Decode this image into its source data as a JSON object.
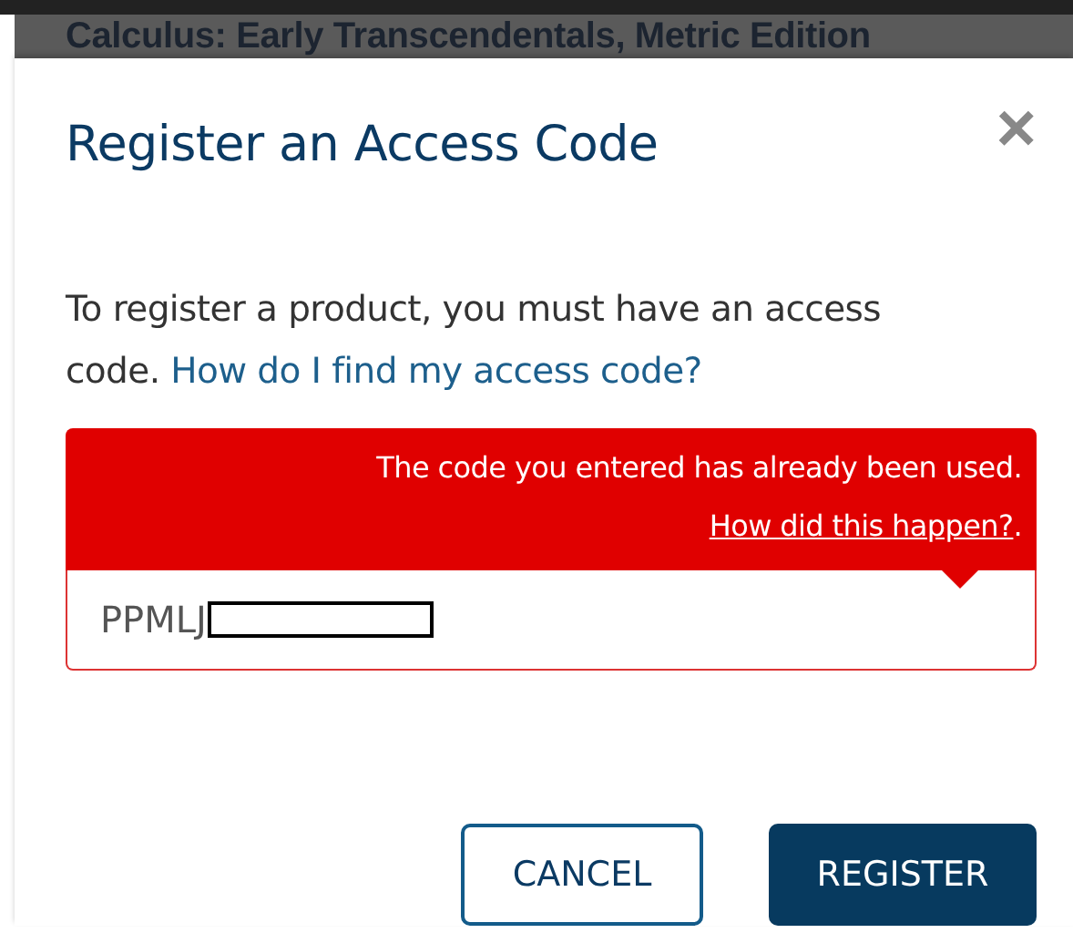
{
  "background": {
    "title": "Calculus: Early Transcendentals, Metric Edition"
  },
  "dialog": {
    "title": "Register an Access Code",
    "close": "×",
    "intro": "To register a product, you must have an access code.",
    "help_link": "How do I find my access code?",
    "error": {
      "message": "The code you entered has already been used.",
      "link": "How did this happen?",
      "end": "."
    },
    "code_field": {
      "value": "PPMLJ",
      "redacted": true
    },
    "buttons": [
      {
        "label": "CANCEL",
        "kind": "secondary"
      },
      {
        "label": "REGISTER",
        "kind": "primary"
      }
    ]
  }
}
